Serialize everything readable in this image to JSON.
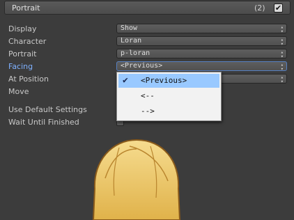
{
  "header": {
    "title": "Portrait",
    "count": "(2)",
    "enabled": true
  },
  "rows": [
    {
      "label": "Display",
      "value": "Show"
    },
    {
      "label": "Character",
      "value": "Loran"
    },
    {
      "label": "Portrait",
      "value": "p-loran"
    },
    {
      "label": "Facing",
      "value": "<Previous>"
    },
    {
      "label": "At Position",
      "value": ""
    },
    {
      "label": "Move"
    },
    {
      "label": "Use Default Settings"
    },
    {
      "label": "Wait Until Finished"
    }
  ],
  "dropdown": {
    "options": [
      "<Previous>",
      "<--",
      "-->"
    ],
    "selected": "<Previous>"
  },
  "icons": {
    "check": "check-icon",
    "dropdown_arrows": "updown-arrows-icon"
  },
  "colors": {
    "accent": "#7fb1ff",
    "selection": "#99c9ff",
    "background": "#3c3c3c"
  }
}
